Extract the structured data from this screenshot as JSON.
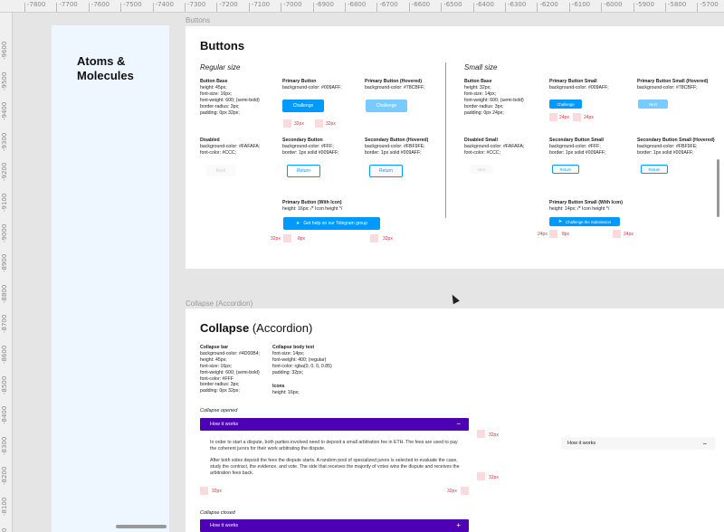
{
  "ruler": {
    "top": [
      "-7800",
      "-7700",
      "-7600",
      "-7500",
      "-7400",
      "-7300",
      "-7200",
      "-7100",
      "-7000",
      "-6900",
      "-6800",
      "-6700",
      "-6600",
      "-6500",
      "-6400",
      "-6300",
      "-6200",
      "-6100",
      "-6000",
      "-5900",
      "-5800",
      "-5700",
      "-5600"
    ],
    "left": [
      "-9600",
      "-9500",
      "-9400",
      "-9300",
      "-9200",
      "-9100",
      "-9000",
      "-8900",
      "-8800",
      "-8700",
      "-8600",
      "-8500",
      "-8400",
      "-8300",
      "-8200",
      "-8100",
      "-8000"
    ]
  },
  "sidebar": {
    "title": "Atoms &\nMolecules"
  },
  "frames": {
    "buttons_label": "Buttons",
    "collapse_label": "Collapse (Accordion)"
  },
  "buttons": {
    "title": "Buttons",
    "regular_caption": "Regular size",
    "small_caption": "Small size",
    "specs": {
      "base": {
        "title": "Button Base",
        "lines": [
          "height: 45px;",
          "font-size: 16px;",
          "font-weight: 600; (semi-bold)",
          "border-radius: 3px;",
          "padding: 0px 32px;"
        ]
      },
      "primary": {
        "title": "Primary Button",
        "lines": [
          "background-color: #009AFF;"
        ]
      },
      "primary_hovered": {
        "title": "Primary Button (Hovered)",
        "lines": [
          "background-color: #78CBFF;"
        ]
      },
      "disabled": {
        "title": "Disabled",
        "lines": [
          "background-color: #FAFAFA;",
          "font-color: #CCC;"
        ]
      },
      "secondary": {
        "title": "Secondary Button",
        "lines": [
          "background-color: #FFF;",
          "border: 1px solid #009AFF;"
        ]
      },
      "secondary_hovered": {
        "title": "Secondary Button (Hovered)",
        "lines": [
          "background-color: #FBF9FE;",
          "border: 1px solid #009AFF;"
        ]
      },
      "primary_icon": {
        "title": "Primary Button (With Icon)",
        "lines": [
          "height: 16px; /* Icon height */"
        ]
      },
      "small_base": {
        "title": "Button Base",
        "lines": [
          "height: 32px;",
          "font-size: 14px;",
          "font-weight: 600; (semi-bold)",
          "border-radius: 3px;",
          "padding: 0px 24px;"
        ]
      },
      "small_primary": {
        "title": "Primary Button Small",
        "lines": [
          "background-color: #009AFF;"
        ]
      },
      "small_primary_hovered": {
        "title": "Primary Button Small (Hovered)",
        "lines": [
          "background-color: #78CBFF;"
        ]
      },
      "small_disabled": {
        "title": "Disabled Small",
        "lines": [
          "background-color: #FAFAFA;",
          "font-color: #CCC;"
        ]
      },
      "small_secondary": {
        "title": "Secondary Button Small",
        "lines": [
          "background-color: #FFF;",
          "border: 1px solid #009AFF;"
        ]
      },
      "small_secondary_hovered": {
        "title": "Secondary Button Small (Hovered)",
        "lines": [
          "background-color: #FBF9FE;",
          "border: 1px solid #009AFF;"
        ]
      },
      "small_primary_icon": {
        "title": "Primary Button Small (With Icon)",
        "lines": [
          "height: 14px; /* Icon height */"
        ]
      }
    },
    "labels": {
      "challenge": "Challenge",
      "next": "Next",
      "return": "Return",
      "telegram": "Get help on our Telegram group",
      "submission": "Challenge the Submission"
    },
    "pads": {
      "p32": "32px",
      "p24": "24px",
      "p8": "8px"
    }
  },
  "collapse": {
    "title": "Collapse",
    "title_suffix": "(Accordion)",
    "bar_spec": {
      "title": "Collapse bar",
      "lines": [
        "background-color: #4D00B4;",
        "height: 45px;",
        "font-size: 16px;",
        "font-weight: 600; (semi-bold)",
        "font-color: #FFF",
        "border-radius: 3px;",
        "padding: 0px 32px;"
      ]
    },
    "body_spec": {
      "title": "Collapse body text",
      "lines": [
        "font-size: 14px;",
        "font-weight: 400; (regular)",
        "font-color: rgba(0, 0, 0, 0.85)",
        "padding: 32px;"
      ]
    },
    "icons_spec": {
      "title": "Icons",
      "lines": [
        "height: 16px;"
      ]
    },
    "opened_caption": "Collapse opened",
    "closed_caption": "Collapse closed",
    "bar_label": "How it works",
    "minus": "−",
    "plus": "+",
    "body_p1": "In order to start a dispute, both parties involved need to deposit a small arbitration fee in ETH. The fees are used to pay the coherent jurors for their work arbitrating the dispute.",
    "body_p2": "After both sides deposit the fees the dispute starts. A random pool of specialized jurors is selected to evaluate the case, study the contract, the evidence, and vote. The side that receives the majority of votes wins the dispute and receives the arbitration fees back.",
    "pad32": "32px"
  }
}
